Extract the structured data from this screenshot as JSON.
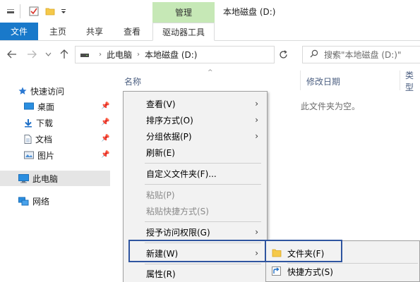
{
  "titlebar": {
    "context_tab_header": "管理",
    "window_title": "本地磁盘 (D:)"
  },
  "ribbon": {
    "tabs": [
      {
        "label": "文件"
      },
      {
        "label": "主页"
      },
      {
        "label": "共享"
      },
      {
        "label": "查看"
      },
      {
        "label": "驱动器工具"
      }
    ]
  },
  "address": {
    "crumbs": [
      "此电脑",
      "本地磁盘 (D:)"
    ],
    "search_placeholder": "搜索\"本地磁盘 (D:)\""
  },
  "navpane": {
    "quick_access": "快速访问",
    "items": [
      {
        "label": "桌面",
        "icon": "desktop-icon"
      },
      {
        "label": "下载",
        "icon": "download-icon"
      },
      {
        "label": "文档",
        "icon": "documents-icon"
      },
      {
        "label": "图片",
        "icon": "pictures-icon"
      }
    ],
    "this_pc": "此电脑",
    "network": "网络"
  },
  "content": {
    "columns": [
      "名称",
      "修改日期",
      "类型"
    ],
    "empty_text": "此文件夹为空。"
  },
  "context_menu": {
    "items": [
      {
        "label": "查看(V)",
        "submenu": true,
        "disabled": false
      },
      {
        "label": "排序方式(O)",
        "submenu": true,
        "disabled": false
      },
      {
        "label": "分组依据(P)",
        "submenu": true,
        "disabled": false
      },
      {
        "label": "刷新(E)",
        "submenu": false,
        "disabled": false
      },
      {
        "label": "自定义文件夹(F)...",
        "submenu": false,
        "disabled": false
      },
      {
        "label": "粘贴(P)",
        "submenu": false,
        "disabled": true
      },
      {
        "label": "粘贴快捷方式(S)",
        "submenu": false,
        "disabled": true
      },
      {
        "label": "授予访问权限(G)",
        "submenu": true,
        "disabled": false
      },
      {
        "label": "新建(W)",
        "submenu": true,
        "disabled": false
      },
      {
        "label": "属性(R)",
        "submenu": false,
        "disabled": false
      }
    ]
  },
  "submenu": {
    "items": [
      {
        "label": "文件夹(F)",
        "icon": "folder-icon"
      },
      {
        "label": "快捷方式(S)",
        "icon": "shortcut-icon"
      }
    ]
  },
  "colors": {
    "file_tab": "#1979ca",
    "context_tab": "#c6e8b6",
    "highlight_frame": "#2f55a0",
    "menu_bg": "#f2f2f2"
  }
}
